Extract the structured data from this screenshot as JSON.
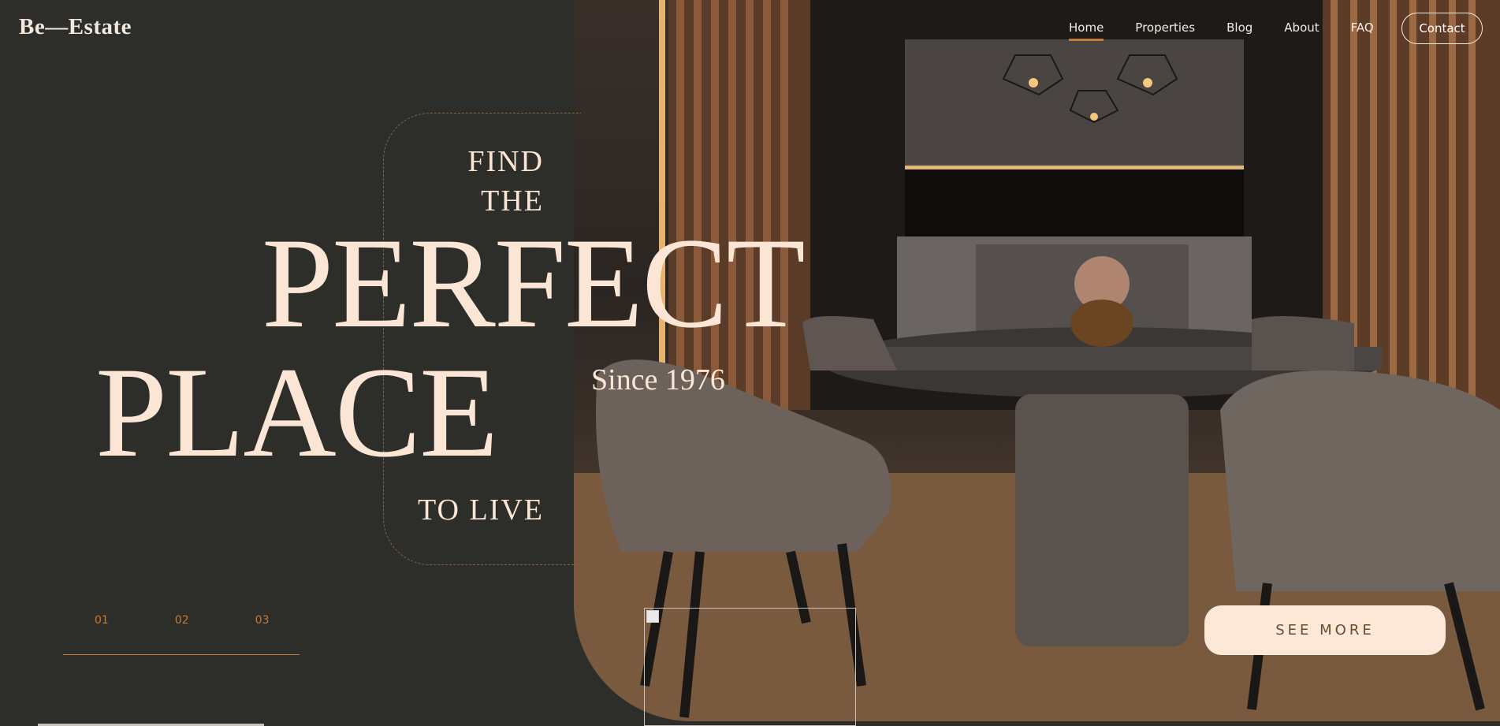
{
  "header": {
    "logo": "Be—Estate",
    "nav": [
      "Home",
      "Properties",
      "Blog",
      "About",
      "FAQ"
    ],
    "contact_label": "Contact"
  },
  "hero": {
    "find": "FIND",
    "the": "THE",
    "perfect": "PERFECT",
    "place": "PLACE",
    "since": "Since 1976",
    "to_live": "TO LIVE",
    "cta": "SEE MORE"
  },
  "slider": {
    "items": [
      "01",
      "02",
      "03"
    ]
  },
  "colors": {
    "background": "#2d2d29",
    "accent": "#c77a33",
    "cream": "#fbe6d6"
  }
}
